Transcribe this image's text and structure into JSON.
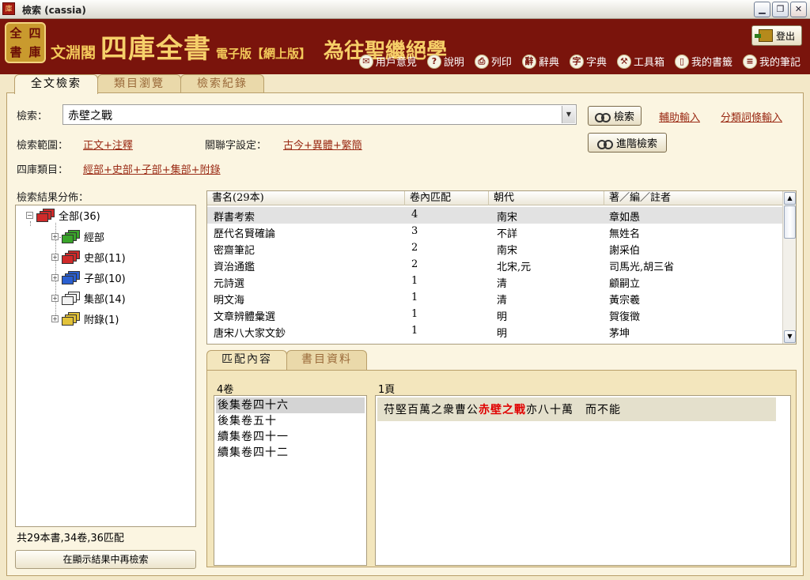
{
  "window": {
    "title": "檢索 (cassia)",
    "app_icon_glyph": "庫"
  },
  "header": {
    "seal_chars": [
      "全",
      "四",
      "書",
      "庫"
    ],
    "brand_prefix": "文淵閣",
    "brand_main": "四庫全書",
    "brand_edition": "電子版【網上版】",
    "brand_motto": "為往聖繼絕學",
    "logout_label": "登出",
    "toolbar": [
      {
        "icon": "feedback-icon",
        "glyph": "✉",
        "label": "用戶意見"
      },
      {
        "icon": "help-icon",
        "glyph": "?",
        "label": "說明"
      },
      {
        "icon": "print-icon",
        "glyph": "⎙",
        "label": "列印"
      },
      {
        "icon": "dictionary-icon",
        "glyph": "辭",
        "label": "辭典"
      },
      {
        "icon": "character-dictionary-icon",
        "glyph": "字",
        "label": "字典"
      },
      {
        "icon": "toolbox-icon",
        "glyph": "⚒",
        "label": "工具箱"
      },
      {
        "icon": "bookmark-icon",
        "glyph": "▯",
        "label": "我的書籤"
      },
      {
        "icon": "notes-icon",
        "glyph": "≡",
        "label": "我的筆記"
      }
    ]
  },
  "main_tabs": [
    {
      "label": "全文檢索",
      "active": true
    },
    {
      "label": "類目瀏覽",
      "active": false
    },
    {
      "label": "檢索紀錄",
      "active": false
    }
  ],
  "search": {
    "label": "檢索：",
    "value": "赤壁之戰",
    "search_button": "檢索",
    "advanced_button": "進階檢索",
    "assist_input_link": "輔助輸入",
    "category_input_link": "分類詞條輸入",
    "scope_label": "檢索範圍：",
    "scope_value": "正文+注釋",
    "related_label": "關聯字設定：",
    "related_value": "古今+異體+繁簡",
    "category_label": "四庫類目：",
    "category_value": "經部+史部+子部+集部+附錄"
  },
  "results_distribution": {
    "label": "檢索結果分佈：",
    "tree": [
      {
        "label": "全部(36)",
        "color": "#d02a2a",
        "level": 0
      },
      {
        "label": "經部",
        "color": "#3aa52a",
        "level": 1
      },
      {
        "label": "史部(11)",
        "color": "#d02a2a",
        "level": 1
      },
      {
        "label": "子部(10)",
        "color": "#2a5fd0",
        "level": 1
      },
      {
        "label": "集部(14)",
        "color": "#f2f2f2",
        "level": 1
      },
      {
        "label": "附錄(1)",
        "color": "#e2c23a",
        "level": 1
      }
    ],
    "summary": "共29本書,34卷,36匹配",
    "refine_button": "在顯示結果中再檢索"
  },
  "results_table": {
    "headers": [
      "書名(29本)",
      "卷內匹配",
      "朝代",
      "著／編／註者"
    ],
    "rows": [
      [
        "群書考索",
        "4",
        "南宋",
        "章如愚"
      ],
      [
        "歷代名賢確論",
        "3",
        "不詳",
        "無姓名"
      ],
      [
        "密齋筆記",
        "2",
        "南宋",
        "謝采伯"
      ],
      [
        "資治通鑑",
        "2",
        "北宋,元",
        "司馬光,胡三省"
      ],
      [
        "元詩選",
        "1",
        "清",
        "顧嗣立"
      ],
      [
        "明文海",
        "1",
        "清",
        "黃宗羲"
      ],
      [
        "文章辨體彙選",
        "1",
        "明",
        "賀復徵"
      ],
      [
        "唐宋八大家文鈔",
        "1",
        "明",
        "茅坤"
      ]
    ]
  },
  "detail_tabs": [
    {
      "label": "匹配內容",
      "active": true
    },
    {
      "label": "書目資料",
      "active": false
    }
  ],
  "detail": {
    "juan_count": "4卷",
    "page_count": "1頁",
    "juan_list": [
      "後集卷四十六",
      "後集卷五十",
      "續集卷四十一",
      "續集卷四十二"
    ],
    "text_before": "苻堅百萬之衆曹公",
    "text_highlight": "赤壁之戰",
    "text_after": "亦八十萬　而不能"
  }
}
